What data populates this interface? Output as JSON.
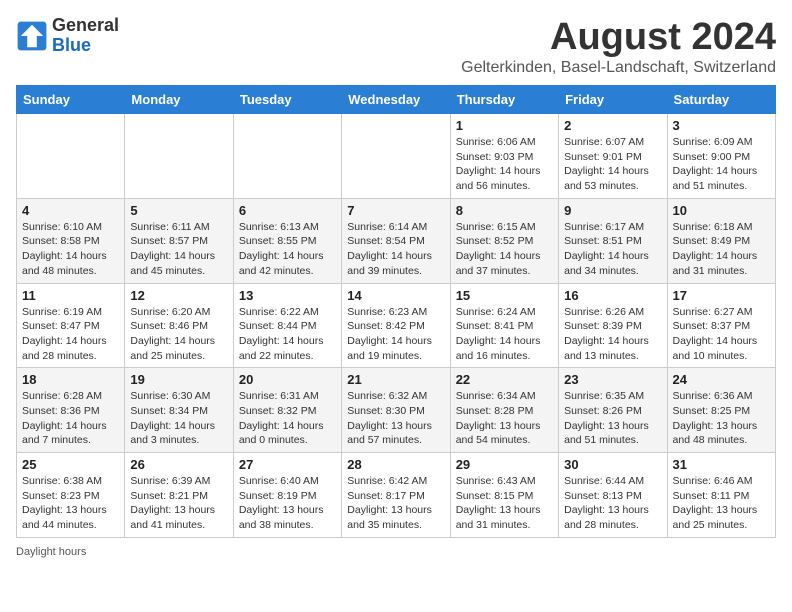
{
  "logo": {
    "general": "General",
    "blue": "Blue"
  },
  "title": "August 2024",
  "subtitle": "Gelterkinden, Basel-Landschaft, Switzerland",
  "days_of_week": [
    "Sunday",
    "Monday",
    "Tuesday",
    "Wednesday",
    "Thursday",
    "Friday",
    "Saturday"
  ],
  "weeks": [
    [
      {
        "day": "",
        "info": ""
      },
      {
        "day": "",
        "info": ""
      },
      {
        "day": "",
        "info": ""
      },
      {
        "day": "",
        "info": ""
      },
      {
        "day": "1",
        "info": "Sunrise: 6:06 AM\nSunset: 9:03 PM\nDaylight: 14 hours and 56 minutes."
      },
      {
        "day": "2",
        "info": "Sunrise: 6:07 AM\nSunset: 9:01 PM\nDaylight: 14 hours and 53 minutes."
      },
      {
        "day": "3",
        "info": "Sunrise: 6:09 AM\nSunset: 9:00 PM\nDaylight: 14 hours and 51 minutes."
      }
    ],
    [
      {
        "day": "4",
        "info": "Sunrise: 6:10 AM\nSunset: 8:58 PM\nDaylight: 14 hours and 48 minutes."
      },
      {
        "day": "5",
        "info": "Sunrise: 6:11 AM\nSunset: 8:57 PM\nDaylight: 14 hours and 45 minutes."
      },
      {
        "day": "6",
        "info": "Sunrise: 6:13 AM\nSunset: 8:55 PM\nDaylight: 14 hours and 42 minutes."
      },
      {
        "day": "7",
        "info": "Sunrise: 6:14 AM\nSunset: 8:54 PM\nDaylight: 14 hours and 39 minutes."
      },
      {
        "day": "8",
        "info": "Sunrise: 6:15 AM\nSunset: 8:52 PM\nDaylight: 14 hours and 37 minutes."
      },
      {
        "day": "9",
        "info": "Sunrise: 6:17 AM\nSunset: 8:51 PM\nDaylight: 14 hours and 34 minutes."
      },
      {
        "day": "10",
        "info": "Sunrise: 6:18 AM\nSunset: 8:49 PM\nDaylight: 14 hours and 31 minutes."
      }
    ],
    [
      {
        "day": "11",
        "info": "Sunrise: 6:19 AM\nSunset: 8:47 PM\nDaylight: 14 hours and 28 minutes."
      },
      {
        "day": "12",
        "info": "Sunrise: 6:20 AM\nSunset: 8:46 PM\nDaylight: 14 hours and 25 minutes."
      },
      {
        "day": "13",
        "info": "Sunrise: 6:22 AM\nSunset: 8:44 PM\nDaylight: 14 hours and 22 minutes."
      },
      {
        "day": "14",
        "info": "Sunrise: 6:23 AM\nSunset: 8:42 PM\nDaylight: 14 hours and 19 minutes."
      },
      {
        "day": "15",
        "info": "Sunrise: 6:24 AM\nSunset: 8:41 PM\nDaylight: 14 hours and 16 minutes."
      },
      {
        "day": "16",
        "info": "Sunrise: 6:26 AM\nSunset: 8:39 PM\nDaylight: 14 hours and 13 minutes."
      },
      {
        "day": "17",
        "info": "Sunrise: 6:27 AM\nSunset: 8:37 PM\nDaylight: 14 hours and 10 minutes."
      }
    ],
    [
      {
        "day": "18",
        "info": "Sunrise: 6:28 AM\nSunset: 8:36 PM\nDaylight: 14 hours and 7 minutes."
      },
      {
        "day": "19",
        "info": "Sunrise: 6:30 AM\nSunset: 8:34 PM\nDaylight: 14 hours and 3 minutes."
      },
      {
        "day": "20",
        "info": "Sunrise: 6:31 AM\nSunset: 8:32 PM\nDaylight: 14 hours and 0 minutes."
      },
      {
        "day": "21",
        "info": "Sunrise: 6:32 AM\nSunset: 8:30 PM\nDaylight: 13 hours and 57 minutes."
      },
      {
        "day": "22",
        "info": "Sunrise: 6:34 AM\nSunset: 8:28 PM\nDaylight: 13 hours and 54 minutes."
      },
      {
        "day": "23",
        "info": "Sunrise: 6:35 AM\nSunset: 8:26 PM\nDaylight: 13 hours and 51 minutes."
      },
      {
        "day": "24",
        "info": "Sunrise: 6:36 AM\nSunset: 8:25 PM\nDaylight: 13 hours and 48 minutes."
      }
    ],
    [
      {
        "day": "25",
        "info": "Sunrise: 6:38 AM\nSunset: 8:23 PM\nDaylight: 13 hours and 44 minutes."
      },
      {
        "day": "26",
        "info": "Sunrise: 6:39 AM\nSunset: 8:21 PM\nDaylight: 13 hours and 41 minutes."
      },
      {
        "day": "27",
        "info": "Sunrise: 6:40 AM\nSunset: 8:19 PM\nDaylight: 13 hours and 38 minutes."
      },
      {
        "day": "28",
        "info": "Sunrise: 6:42 AM\nSunset: 8:17 PM\nDaylight: 13 hours and 35 minutes."
      },
      {
        "day": "29",
        "info": "Sunrise: 6:43 AM\nSunset: 8:15 PM\nDaylight: 13 hours and 31 minutes."
      },
      {
        "day": "30",
        "info": "Sunrise: 6:44 AM\nSunset: 8:13 PM\nDaylight: 13 hours and 28 minutes."
      },
      {
        "day": "31",
        "info": "Sunrise: 6:46 AM\nSunset: 8:11 PM\nDaylight: 13 hours and 25 minutes."
      }
    ]
  ],
  "footer": "Daylight hours"
}
